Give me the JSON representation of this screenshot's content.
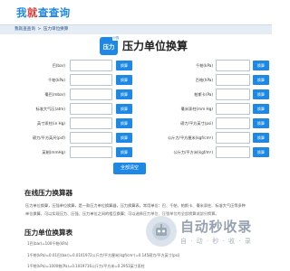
{
  "header": {
    "logo_c1": "我",
    "logo_c2": "就",
    "logo_c3": "查查询"
  },
  "breadcrumb": {
    "home": "我就查查询",
    "sep": ">",
    "current": "压力单位换算"
  },
  "calculator": {
    "badge": "压力",
    "badge_corner": "计算",
    "title": "压力单位换算",
    "button_label": "换算",
    "clear_label": "全部清空",
    "fields": [
      {
        "label": "巴(bar)",
        "value": ""
      },
      {
        "label": "千帕(kPa)",
        "value": ""
      },
      {
        "label": "千帕(kPa)",
        "value": ""
      },
      {
        "label": "百帕(hPa)",
        "value": ""
      },
      {
        "label": "毫巴(mbar)",
        "value": ""
      },
      {
        "label": "帕斯卡(Pa)",
        "value": ""
      },
      {
        "label": "标准大气压(atm)",
        "value": ""
      },
      {
        "label": "毫米汞柱(mm Hg)",
        "value": ""
      },
      {
        "label": "英寸汞柱(in Hg)",
        "value": ""
      },
      {
        "label": "磅力/平方英寸(psi)",
        "value": ""
      },
      {
        "label": "磅力/平方英尺(psf)",
        "value": ""
      },
      {
        "label": "公斤力/平方厘米(kgf/cm²)",
        "value": ""
      },
      {
        "label": "英制(mmHg)",
        "value": ""
      },
      {
        "label": "公斤力/平方米(kgf/m²)",
        "value": ""
      }
    ]
  },
  "article": {
    "section1_title": "在线压力换算器",
    "section1_text": "压力单位换算，压强单位换算，是一款压力单位换算器，压力换算表，常用单位：巴、千帕、帕斯卡、毫米汞柱、标准大气压等多种单位换算，可以实现压力、压强、压力单位之间的相互换算；可以选择压力单位、压强单位的全部换算或部分换算。",
    "section2_title": "压力单位换算表",
    "formulas": [
      "1巴(bar)=100千帕(kPa)",
      "1千帕(kPa)=0.01巴(bar)=0.0101972公斤力/平方厘米(kgf/cm²)=0.145磅力/平方英寸(psi)",
      "1千帕(kPa)=1000帕(Pa)=0.1019716公斤力/平方米=0.2953英寸汞柱"
    ]
  },
  "watermark": {
    "title": "自动秒收录",
    "sub": "自 · 动 · 秒 · 收 · 录"
  }
}
